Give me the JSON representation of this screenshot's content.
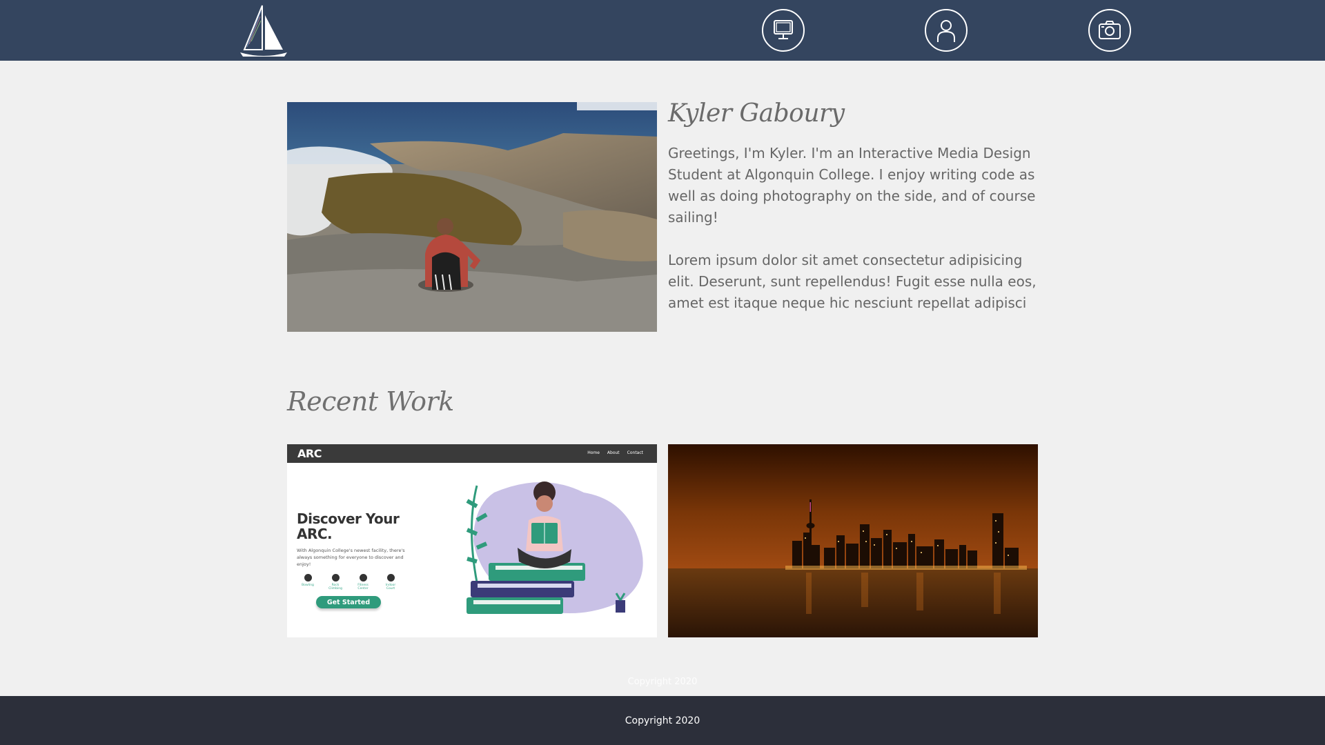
{
  "nav": {
    "logo": "sailboat-logo",
    "icons": [
      "computer-icon",
      "profile-icon",
      "camera-icon"
    ]
  },
  "about": {
    "name": "Kyler Gaboury",
    "intro": "Greetings, I'm Kyler. I'm an Interactive Media Design Student at Algonquin College. I enjoy writing code as well as doing photography on the side, and of course sailing!",
    "body": "Lorem ipsum dolor sit amet consectetur adipisicing elit. Deserunt, sunt repellendus! Fugit esse nulla eos, amet est itaque neque hic nesciunt repellat adipisci"
  },
  "recent": {
    "title": "Recent Work",
    "arc": {
      "logo": "ARC",
      "links": [
        "Home",
        "About",
        "Contact"
      ],
      "heading": "Discover Your ARC.",
      "body": "With Algonquin College's newest facility, there's always something for everyone to discover and enjoy!",
      "features": [
        "Bowling",
        "Rock Climbing",
        "Fitness Center",
        "Indoor Court"
      ],
      "cta": "Get Started"
    }
  },
  "footer": {
    "ghost": "Copyright 2020",
    "text": "Copyright 2020"
  },
  "colors": {
    "nav": "#34455f",
    "footer": "#2c2f3a",
    "background": "#f0f0f0",
    "accent": "#2f9b7c"
  }
}
